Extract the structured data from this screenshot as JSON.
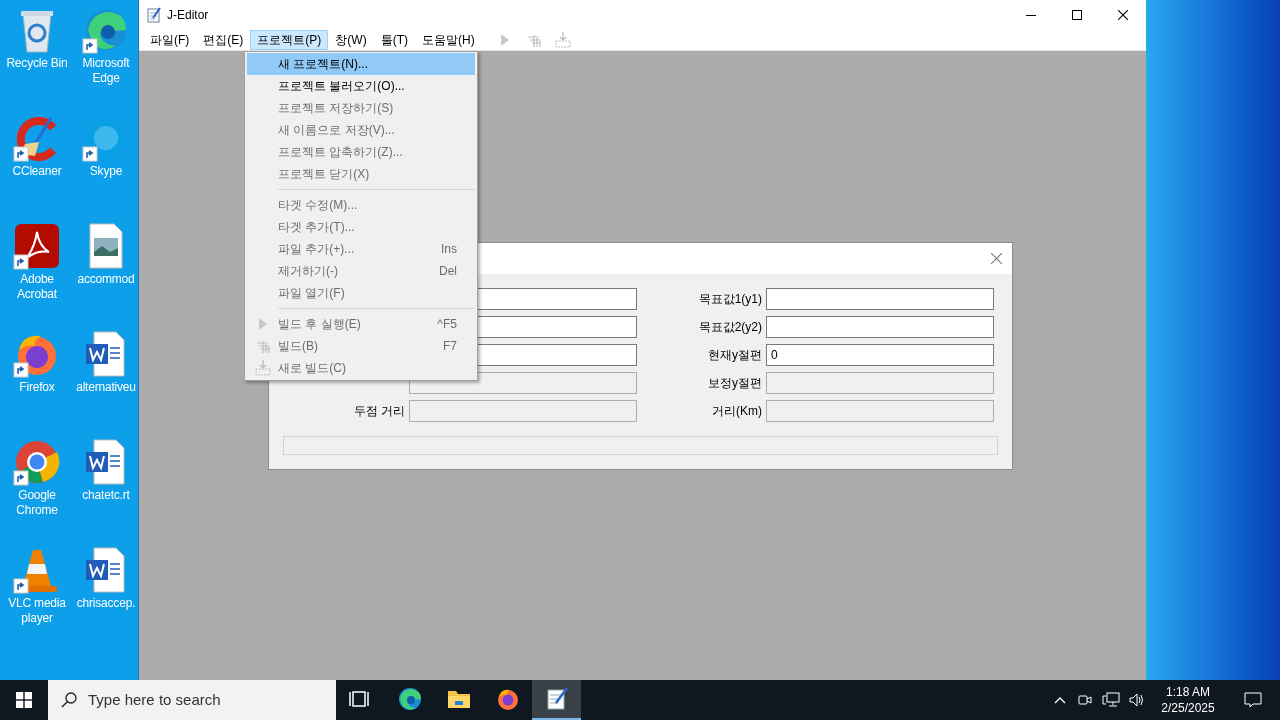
{
  "desktop_icons": [
    {
      "label": "Recycle Bin",
      "kind": "recycle",
      "shortcut": false
    },
    {
      "label": "Microsoft Edge",
      "kind": "edge",
      "shortcut": true
    },
    {
      "label": "CCleaner",
      "kind": "ccleaner",
      "shortcut": true
    },
    {
      "label": "Skype",
      "kind": "skype",
      "shortcut": true
    },
    {
      "label": "Adobe Acrobat",
      "kind": "acrobat",
      "shortcut": true
    },
    {
      "label": "accommod",
      "kind": "image",
      "shortcut": false
    },
    {
      "label": "Firefox",
      "kind": "firefox",
      "shortcut": true
    },
    {
      "label": "alternativeu",
      "kind": "word",
      "shortcut": false
    },
    {
      "label": "Google Chrome",
      "kind": "chrome",
      "shortcut": true
    },
    {
      "label": "chatetc.rt",
      "kind": "word",
      "shortcut": false
    },
    {
      "label": "VLC media player",
      "kind": "vlc",
      "shortcut": true
    },
    {
      "label": "chrisaccep.",
      "kind": "word",
      "shortcut": false
    }
  ],
  "window": {
    "title": "J-Editor",
    "menu": [
      {
        "label": "파일(F)",
        "selected": false
      },
      {
        "label": "편집(E)",
        "selected": false
      },
      {
        "label": "프로젝트(P)",
        "selected": true
      },
      {
        "label": "창(W)",
        "selected": false
      },
      {
        "label": "툴(T)",
        "selected": false
      },
      {
        "label": "도움말(H)",
        "selected": false
      }
    ],
    "toolbar": [
      {
        "kind": "run"
      },
      {
        "kind": "build"
      },
      {
        "kind": "rebuild"
      }
    ]
  },
  "project_menu": [
    {
      "kind": "item",
      "label": "새 프로젝트(N)...",
      "enabled": true,
      "selected": true
    },
    {
      "kind": "item",
      "label": "프로젝트 불러오기(O)...",
      "enabled": true,
      "selected": false
    },
    {
      "kind": "item",
      "label": "프로젝트 저장하기(S)",
      "enabled": false,
      "selected": false
    },
    {
      "kind": "item",
      "label": "새 이름으로 저장(V)...",
      "enabled": false,
      "selected": false
    },
    {
      "kind": "item",
      "label": "프로젝트 압축하기(Z)...",
      "enabled": false,
      "selected": false
    },
    {
      "kind": "item",
      "label": "프로젝트 닫기(X)",
      "enabled": false,
      "selected": false
    },
    {
      "kind": "separator"
    },
    {
      "kind": "item",
      "label": "타겟 수정(M)...",
      "enabled": false,
      "selected": false
    },
    {
      "kind": "item",
      "label": "타겟 추가(T)...",
      "enabled": false,
      "selected": false
    },
    {
      "kind": "item",
      "label": "파일 추가(+)...",
      "shortcut": "Ins",
      "enabled": false,
      "selected": false
    },
    {
      "kind": "item",
      "label": "제거하기(-)",
      "shortcut": "Del",
      "enabled": false,
      "selected": false
    },
    {
      "kind": "item",
      "label": "파일 열기(F)",
      "enabled": false,
      "selected": false
    },
    {
      "kind": "separator"
    },
    {
      "kind": "run",
      "label": "빌드 후 실행(E)",
      "shortcut": "^F5",
      "enabled": false,
      "selected": false
    },
    {
      "kind": "build",
      "label": "빌드(B)",
      "shortcut": "F7",
      "enabled": false,
      "selected": false
    },
    {
      "kind": "rebuild",
      "label": "새로 빌드(C)",
      "enabled": false,
      "selected": false
    }
  ],
  "dialog": {
    "left_fields": [
      {
        "disabled": false
      },
      {
        "disabled": false
      },
      {
        "disabled": false
      },
      {
        "disabled": true
      },
      {
        "label": "두점 거리",
        "disabled": true
      }
    ],
    "right_fields": [
      {
        "label": "목표값1(y1)",
        "disabled": false
      },
      {
        "label": "목표값2(y2)",
        "disabled": false
      },
      {
        "label": "현재y절편",
        "value": "0",
        "disabled": false
      },
      {
        "label": "보정y절편",
        "disabled": true
      },
      {
        "label": "거리(Km)",
        "disabled": true
      }
    ]
  },
  "taskbar": {
    "search": {
      "placeholder": "Type here to search"
    },
    "apps": [
      {
        "kind": "taskview",
        "active": false
      },
      {
        "kind": "edge",
        "active": false
      },
      {
        "kind": "explorer",
        "active": false
      },
      {
        "kind": "firefox",
        "active": false
      },
      {
        "kind": "notepad",
        "active": true
      }
    ],
    "tray": {
      "time": "1:18 AM",
      "date": "2/25/2025"
    }
  }
}
